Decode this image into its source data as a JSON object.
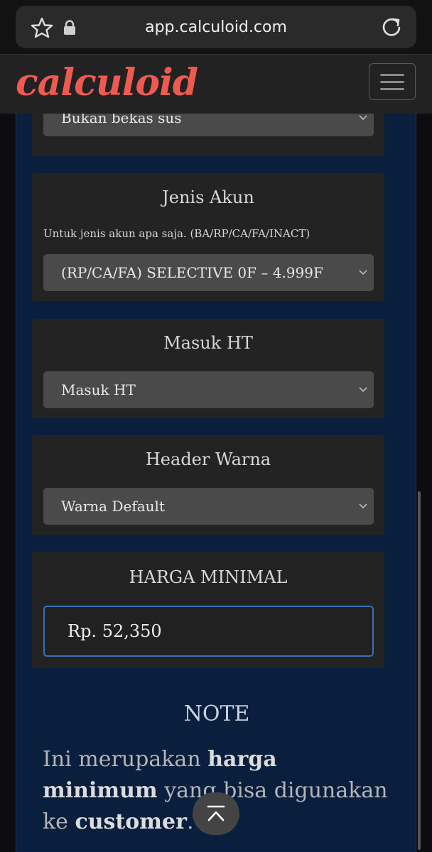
{
  "browser": {
    "url": "app.calculoid.com",
    "icons": [
      "star-icon",
      "lock-icon",
      "reload-icon"
    ]
  },
  "header": {
    "logo": "calculoid",
    "logo_color": "#ef5a50",
    "menu_icon": "hamburger-icon"
  },
  "colors": {
    "panel_bg": "#0a1f3d",
    "card_bg": "#232323",
    "select_bg": "#4a4a4a",
    "input_border": "#3a6fb5"
  },
  "fields": [
    {
      "selected": "Bukan bekas sus"
    },
    {
      "title": "Jenis Akun",
      "description": "Untuk jenis akun apa saja. (BA/RP/CA/FA/INACT)",
      "selected": "(RP/CA/FA) SELECTIVE 0F – 4.999F"
    },
    {
      "title": "Masuk HT",
      "selected": "Masuk HT"
    },
    {
      "title": "Header Warna",
      "selected": "Warna Default"
    }
  ],
  "price": {
    "title": "HARGA MINIMAL",
    "value": "Rp. 52,350"
  },
  "note": {
    "title": "NOTE",
    "part1": "Ini merupakan ",
    "bold1": "harga minimum",
    "part2": " yang bisa digunakan ke ",
    "bold2": "customer",
    "part3": "."
  }
}
